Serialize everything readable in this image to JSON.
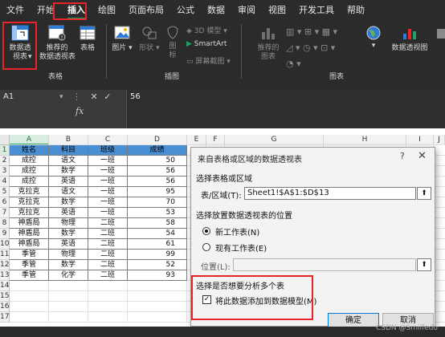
{
  "menu": {
    "items": [
      "文件",
      "开始",
      "插入",
      "绘图",
      "页面布局",
      "公式",
      "数据",
      "审阅",
      "视图",
      "开发工具",
      "帮助"
    ],
    "active": "插入"
  },
  "ribbon": {
    "pivot_table": "数据透\n视表",
    "pivot_table_arrow": "▾",
    "recommended_pivot": "推荐的\n数据透视表",
    "table": "表格",
    "pictures": "图片",
    "shapes": "形状",
    "icons": "图\n标",
    "model_3d": "3D 模型",
    "smartart": "SmartArt",
    "screenshot": "屏幕截图",
    "recommended_charts": "推荐的\n图表",
    "pivot_chart": "数据透视图",
    "group_tables": "表格",
    "group_illustrations": "插图",
    "group_charts": "图表"
  },
  "formula_bar": {
    "name_box": "A1",
    "value": "56"
  },
  "columns": [
    "A",
    "B",
    "C",
    "D",
    "E",
    "F",
    "G",
    "H",
    "I",
    "J"
  ],
  "rows": [
    "1",
    "2",
    "3",
    "4",
    "5",
    "6",
    "7",
    "8",
    "9",
    "10",
    "11",
    "12",
    "13",
    "14",
    "15",
    "16",
    "17"
  ],
  "table": {
    "headers": [
      "姓名",
      "科目",
      "班级",
      "成绩"
    ],
    "rows": [
      [
        "成控",
        "语文",
        "一班",
        "50"
      ],
      [
        "成控",
        "数学",
        "一班",
        "56"
      ],
      [
        "成控",
        "英语",
        "一班",
        "56"
      ],
      [
        "克拉克",
        "语文",
        "一班",
        "95"
      ],
      [
        "克拉克",
        "数学",
        "一班",
        "70"
      ],
      [
        "克拉克",
        "英语",
        "一班",
        "53"
      ],
      [
        "神盾局",
        "物理",
        "二班",
        "58"
      ],
      [
        "神盾局",
        "数学",
        "二班",
        "54"
      ],
      [
        "神盾局",
        "英语",
        "二班",
        "61"
      ],
      [
        "季管",
        "物理",
        "二班",
        "99"
      ],
      [
        "季管",
        "数学",
        "二班",
        "52"
      ],
      [
        "季管",
        "化学",
        "二班",
        "93"
      ]
    ]
  },
  "dialog": {
    "title": "来自表格或区域的数据透视表",
    "help": "?",
    "close": "✕",
    "section_select": "选择表格或区域",
    "range_label": "表/区域(T):",
    "range_value": "Sheet1!$A$1:$D$13",
    "section_place": "选择放置数据透视表的位置",
    "option_new": "新工作表(N)",
    "option_existing": "现有工作表(E)",
    "location_label": "位置(L):",
    "location_value": "",
    "section_multi": "选择是否想要分析多个表",
    "checkbox_label": "将此数据添加到数据模型(M)",
    "checkbox_checked": true,
    "ok": "确定",
    "cancel": "取消",
    "ref_glyph": "⬆"
  },
  "watermark": "CSDN @Smilfedo",
  "colors": {
    "header_fill": "#4a8fd4",
    "highlight": "#e8242a",
    "accent": "#21a366"
  }
}
